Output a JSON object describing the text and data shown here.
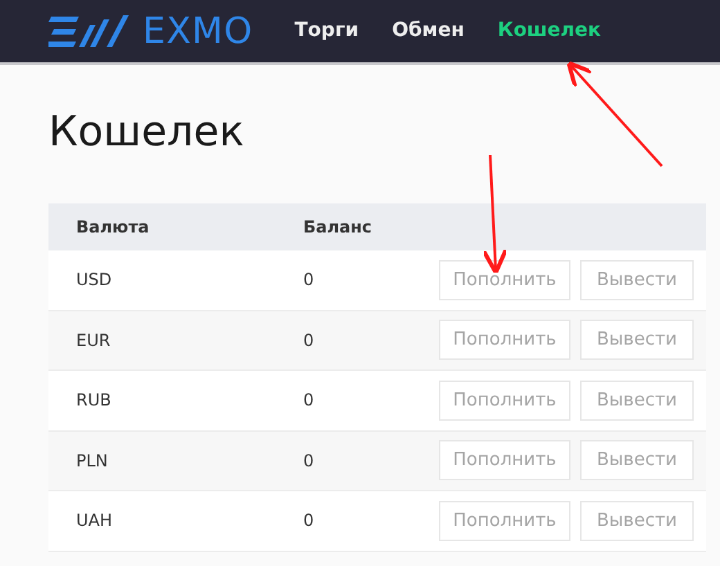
{
  "header": {
    "logo": "EXMO",
    "nav": [
      {
        "label": "Торги",
        "selected": false
      },
      {
        "label": "Обмен",
        "selected": false
      },
      {
        "label": "Кошелек",
        "selected": true
      }
    ]
  },
  "page_title": "Кошелек",
  "table": {
    "columns": [
      "Валюта",
      "Баланс"
    ],
    "rows": [
      {
        "currency": "USD",
        "balance": "0",
        "actions": [
          "Пополнить",
          "Вывести"
        ]
      },
      {
        "currency": "EUR",
        "balance": "0",
        "actions": [
          "Пополнить",
          "Вывести"
        ]
      },
      {
        "currency": "RUB",
        "balance": "0",
        "actions": [
          "Пополнить",
          "Вывести"
        ]
      },
      {
        "currency": "PLN",
        "balance": "0",
        "actions": [
          "Пополнить",
          "Вывести"
        ]
      },
      {
        "currency": "UAH",
        "balance": "0",
        "actions": [
          "Пополнить",
          "Вывести"
        ]
      }
    ]
  }
}
